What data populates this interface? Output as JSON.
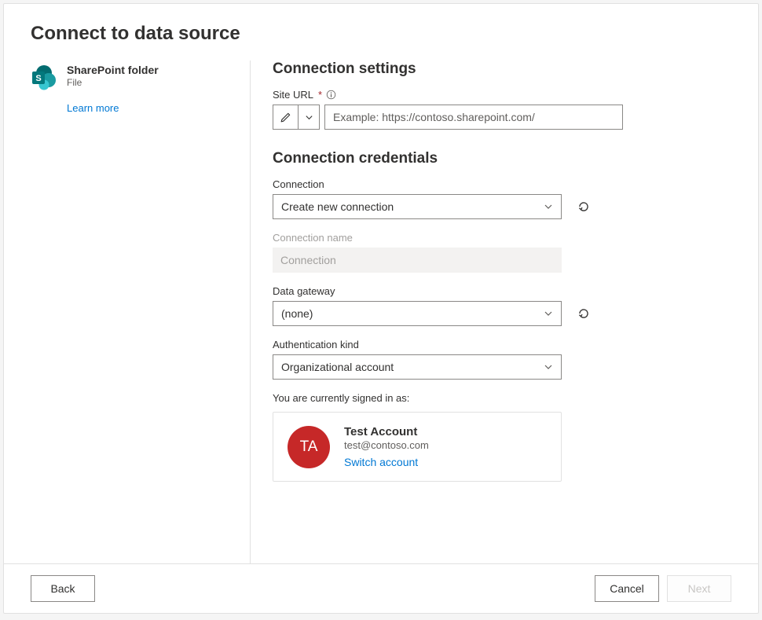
{
  "header": {
    "title": "Connect to data source"
  },
  "left": {
    "source_title": "SharePoint folder",
    "source_subtitle": "File",
    "learn_more": "Learn more"
  },
  "settings": {
    "section_title": "Connection settings",
    "site_url_label": "Site URL",
    "site_url_placeholder": "Example: https://contoso.sharepoint.com/"
  },
  "credentials": {
    "section_title": "Connection credentials",
    "connection_label": "Connection",
    "connection_value": "Create new connection",
    "connection_name_label": "Connection name",
    "connection_name_value": "Connection",
    "gateway_label": "Data gateway",
    "gateway_value": "(none)",
    "auth_label": "Authentication kind",
    "auth_value": "Organizational account",
    "signed_in_label": "You are currently signed in as:",
    "account": {
      "initials": "TA",
      "name": "Test Account",
      "email": "test@contoso.com",
      "switch": "Switch account"
    }
  },
  "footer": {
    "back": "Back",
    "cancel": "Cancel",
    "next": "Next"
  },
  "colors": {
    "link": "#0078d4",
    "sharepoint": "#036c70",
    "avatar": "#c62828"
  }
}
